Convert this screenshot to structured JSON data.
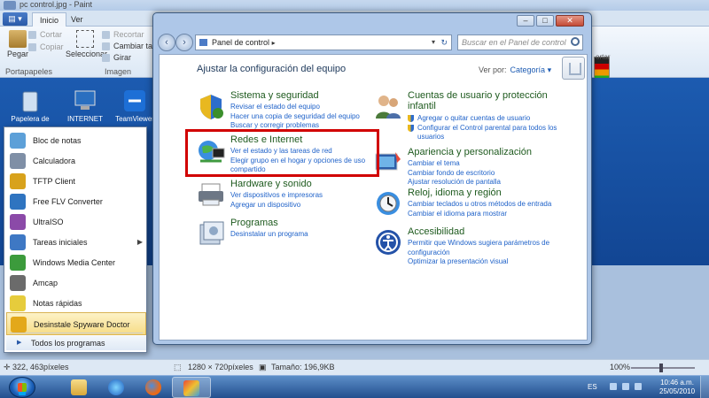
{
  "paint": {
    "title": "pc control.jpg - Paint",
    "tabs": [
      "Inicio",
      "Ver"
    ],
    "clipboard": {
      "paste": "Pegar",
      "cut": "Cortar",
      "copy": "Copiar",
      "group": "Portapapeles"
    },
    "image": {
      "select": "Seleccionar",
      "crop": "Recortar",
      "resize": "Cambiar tama",
      "rotate": "Girar",
      "group": "Imagen"
    },
    "right_label": "ortar",
    "status": {
      "cursor": "322, 463píxeles",
      "size": "1280 × 720píxeles",
      "filesize": "Tamaño: 196,9KB",
      "zoom": "100%"
    }
  },
  "desktop_icons": [
    {
      "label": "Papelera de",
      "icon": "recycle-bin-icon"
    },
    {
      "label": "INTERNET",
      "icon": "network-icon"
    },
    {
      "label": "TeamViewer",
      "icon": "teamviewer-icon"
    }
  ],
  "start_menu": {
    "items": [
      {
        "label": "Bloc de notas",
        "color": "#5da0d8",
        "arrow": false
      },
      {
        "label": "Calculadora",
        "color": "#7f8fa6",
        "arrow": false
      },
      {
        "label": "TFTP Client",
        "color": "#d8a21c",
        "arrow": false
      },
      {
        "label": "Free FLV Converter",
        "color": "#2f74c0",
        "arrow": false
      },
      {
        "label": "UltraISO",
        "color": "#8b4aa8",
        "arrow": false
      },
      {
        "label": "Tareas iniciales",
        "color": "#3e78c4",
        "arrow": true
      },
      {
        "label": "Windows Media Center",
        "color": "#3c9b3c",
        "arrow": false
      },
      {
        "label": "Amcap",
        "color": "#6b6b6b",
        "arrow": false
      },
      {
        "label": "Notas rápidas",
        "color": "#e6cc3c",
        "arrow": false
      },
      {
        "label": "Desinstale Spyware Doctor",
        "color": "#e3a81a",
        "arrow": false
      }
    ],
    "all_programs": "Todos los programas"
  },
  "control_panel": {
    "address": "Panel de control",
    "search_placeholder": "Buscar en el Panel de control",
    "heading": "Ajustar la configuración del equipo",
    "view_by_label": "Ver por:",
    "view_by_value": "Categoría",
    "categories_left": [
      {
        "title": "Sistema y seguridad",
        "icon": "security-shield-icon",
        "links": [
          "Revisar el estado del equipo",
          "Hacer una copia de seguridad del equipo",
          "Buscar y corregir problemas"
        ]
      },
      {
        "title": "Redes e Internet",
        "icon": "network-globe-icon",
        "links": [
          "Ver el estado y las tareas de red",
          "Elegir grupo en el hogar y opciones de uso",
          "compartido"
        ]
      },
      {
        "title": "Hardware y sonido",
        "icon": "printer-icon",
        "links": [
          "Ver dispositivos e impresoras",
          "Agregar un dispositivo"
        ]
      },
      {
        "title": "Programas",
        "icon": "programs-icon",
        "links": [
          "Desinstalar un programa"
        ]
      }
    ],
    "categories_right": [
      {
        "title": "Cuentas de usuario y protección",
        "title2": "infantil",
        "icon": "users-icon",
        "links": [
          "Agregar o quitar cuentas de usuario",
          "Configurar el Control parental para todos los",
          "usuarios"
        ]
      },
      {
        "title": "Apariencia y personalización",
        "icon": "appearance-icon",
        "links": [
          "Cambiar el tema",
          "Cambiar fondo de escritorio",
          "Ajustar resolución de pantalla"
        ]
      },
      {
        "title": "Reloj, idioma y región",
        "icon": "clock-globe-icon",
        "links": [
          "Cambiar teclados u otros métodos de entrada",
          "Cambiar el idioma para mostrar"
        ]
      },
      {
        "title": "Accesibilidad",
        "icon": "accessibility-icon",
        "links": [
          "Permitir que Windows sugiera parámetros de",
          "configuración",
          "Optimizar la presentación visual"
        ]
      }
    ]
  },
  "taskbar": {
    "language": "ES",
    "time": "10:46 a.m.",
    "date": "25/05/2010"
  },
  "colors": {
    "highlight_box": "#d10000",
    "link": "#1f62c9",
    "category_title": "#1e5a1e"
  }
}
